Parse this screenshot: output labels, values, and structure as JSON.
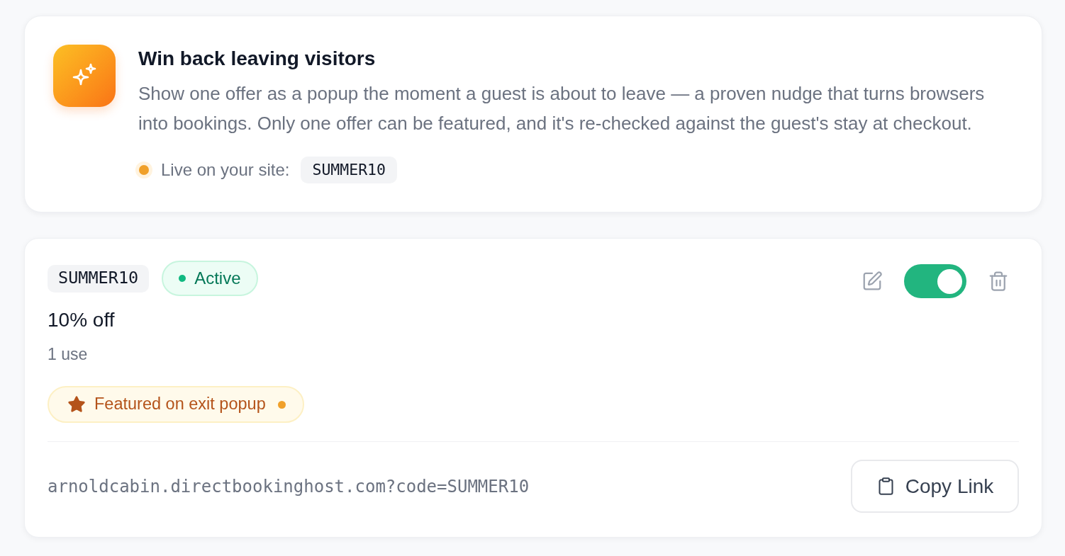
{
  "banner": {
    "title": "Win back leaving visitors",
    "description": "Show one offer as a popup the moment a guest is about to leave — a proven nudge that turns browsers into bookings. Only one offer can be featured, and it's re-checked against the guest's stay at checkout.",
    "live": true,
    "live_label": "Live on your site:",
    "live_code": "SUMMER10"
  },
  "offers": [
    {
      "code": "SUMMER10",
      "status": {
        "label": "Active",
        "kind": "active"
      },
      "enabled": true,
      "discount": "10% off",
      "uses": "1 use",
      "featured": true,
      "featured_label": "Featured on exit popup",
      "link": "arnoldcabin.directbookinghost.com?code=SUMMER10",
      "copy_button": "Copy Link"
    }
  ]
}
